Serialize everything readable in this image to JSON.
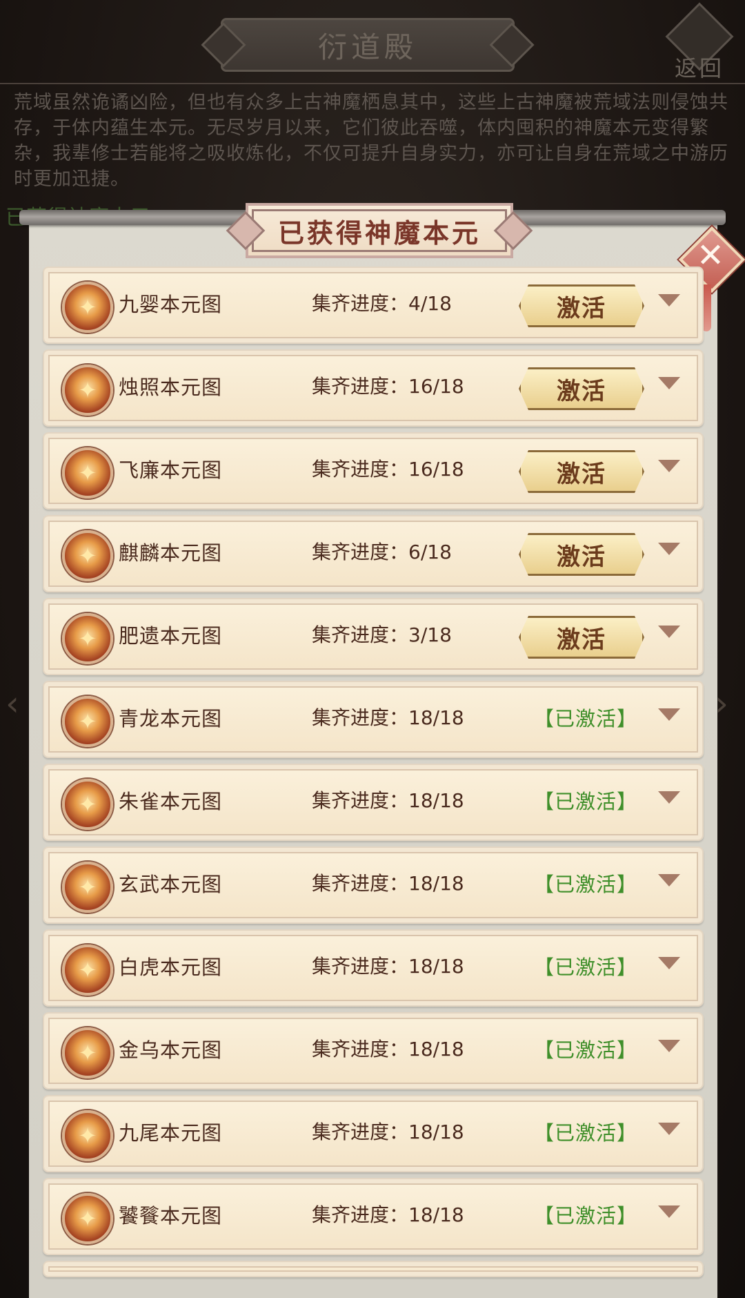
{
  "background": {
    "title": "衍道殿",
    "back_label": "返回",
    "description": "荒域虽然诡谲凶险，但也有众多上古神魔栖息其中，这些上古神魔被荒域法则侵蚀共存，于体内蕴生本元。无尽岁月以来，它们彼此吞噬，体内囤积的神魔本元变得繁杂，我辈修士若能将之吸收炼化，不仅可提升自身实力，亦可让自身在荒域之中游历时更加迅捷。",
    "subheading": "已获得神魔本元"
  },
  "panel": {
    "title": "已获得神魔本元",
    "close_icon": "close-x-icon"
  },
  "list": {
    "progress_label": "集齐进度：",
    "activate_label": "激活",
    "activated_label": "【已激活】",
    "items": [
      {
        "name": "九婴本元图",
        "progress": "4/18",
        "activated": false
      },
      {
        "name": "烛照本元图",
        "progress": "16/18",
        "activated": false
      },
      {
        "name": "飞廉本元图",
        "progress": "16/18",
        "activated": false
      },
      {
        "name": "麒麟本元图",
        "progress": "6/18",
        "activated": false
      },
      {
        "name": "肥遗本元图",
        "progress": "3/18",
        "activated": false
      },
      {
        "name": "青龙本元图",
        "progress": "18/18",
        "activated": true
      },
      {
        "name": "朱雀本元图",
        "progress": "18/18",
        "activated": true
      },
      {
        "name": "玄武本元图",
        "progress": "18/18",
        "activated": true
      },
      {
        "name": "白虎本元图",
        "progress": "18/18",
        "activated": true
      },
      {
        "name": "金乌本元图",
        "progress": "18/18",
        "activated": true
      },
      {
        "name": "九尾本元图",
        "progress": "18/18",
        "activated": true
      },
      {
        "name": "饕餮本元图",
        "progress": "18/18",
        "activated": true
      }
    ]
  },
  "colors": {
    "activated_green": "#3f8f2a",
    "title_red": "#7a3629"
  }
}
